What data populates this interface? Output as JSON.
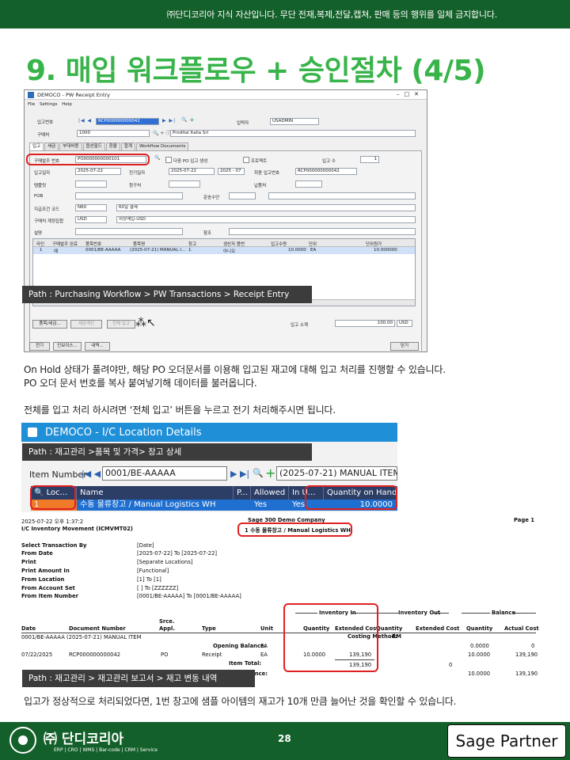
{
  "banner": "㈜단디코리아 지식 자산입니다. 무단 전재,복제,전달,캡쳐,  판매 등의 행위를 일체 금지합니다.",
  "title": "9. 매입 워크플로우 + 승인절차 (4/5)",
  "window1": {
    "title": "DEMOCO - PW Receipt Entry",
    "menu": [
      "File",
      "Settings",
      "Help"
    ],
    "receipt_no_label": "입고번호",
    "receipt_no": "RCP000000000042",
    "entered_by_label": "입력자",
    "entered_by": "USADMIN",
    "vendor_label": "구매처",
    "vendor_code": "1000",
    "vendor_name": "Prodital Italia Srl",
    "tabs": [
      "입고",
      "세금",
      "부대비용",
      "옵션필드",
      "환율",
      "합계",
      "Workflow Documents"
    ],
    "po_no_label": "구매발주 번호",
    "po_no": "PO0000000000101",
    "multi_po_label": "다중 PO 입고 생성",
    "project_label": "프로젝트",
    "receipt_count_label": "입고 수",
    "receipt_count": "1",
    "receipt_date_label": "입고일자",
    "receipt_date": "2025-07-22",
    "posting_date_label": "전기일자",
    "posting_date": "2025-07-22",
    "period": "2025 - 07",
    "last_receipt_label": "최종 입고번호",
    "last_receipt": "RCP000000000042",
    "template_label": "템플릿",
    "billing_label": "청구처",
    "delivery_label": "납품처",
    "fob_label": "FOB",
    "ship_via_label": "운송수단",
    "terms_label": "지급조건 코드",
    "terms_code": "N60",
    "terms_desc": "60일 결제",
    "account_set_label": "구매처 계정집합",
    "account_set": "USD",
    "account_set_desc": "외상매입-USD",
    "description_label": "설명",
    "reference_label": "참조",
    "grid_headers": [
      "라인",
      "구매발주 완료",
      "품목번호",
      "품목명",
      "창고",
      "생산자 품번",
      "입고수량",
      "단위",
      "단위원가"
    ],
    "grid_row": [
      "1",
      "예",
      "0001/BE-AAAAA",
      "(2025-07-21) MANUAL I...",
      "1",
      "아니오",
      "10.0000",
      "EA",
      "10.000000"
    ],
    "path": "Path : Purchasing Workflow > PW Transactions > Receipt Entry",
    "btn_items": "품목/세금...",
    "btn_tax_calc": "세금계산",
    "btn_receive_all": "전체 입고",
    "total_label": "입고 소계",
    "total": "100.00",
    "currency": "USD",
    "btn_post": "전기",
    "btn_invoice": "인보이스...",
    "btn_history": "내역...",
    "btn_close": "닫기"
  },
  "text1": [
    "On Hold 상태가 풀려야만, 해당 PO 오더문서를 이용해 입고된 재고에 대해 입고 처리를 진행할 수 있습니다.",
    "PO 오더 문서 번호를 복사 붙여넣기해 데이터를 불러옵니다."
  ],
  "text2": "전체를 입고 처리 하시려면 ‘전체 입고’ 버튼을 누르고 전기 처리해주시면 됩니다.",
  "window2": {
    "title": "DEMOCO - I/C Location Details",
    "path": "Path : 재고관리 >품목 및 가격> 창고 상세",
    "item_label": "Item Number",
    "item_value": "0001/BE-AAAAA",
    "item_desc": "(2025-07-21) MANUAL ITEM",
    "headers": [
      "Loc...",
      "Name",
      "P...",
      "Allowed",
      "In U...",
      "Quantity on Hand (EA)"
    ],
    "row": [
      "1",
      "수동 물류창고 / Manual Logistics WH",
      "",
      "Yes",
      "Yes",
      "10.0000"
    ]
  },
  "report": {
    "datetime": "2025-07-22  오후 1:37:2",
    "company": "Sage 300 Demo Company",
    "page": "Page 1",
    "name": "I/C Inventory Movement (ICMVMT02)",
    "location_title": "1  수동 물류창고 / Manual Logistics WH",
    "params": [
      [
        "Select Transaction By",
        "[Date]"
      ],
      [
        "From Date",
        "[2025-07-22]  To  [2025-07-22]"
      ],
      [
        "Print",
        "[Separate Locations]"
      ],
      [
        "Print Amount In",
        "[Functional]"
      ],
      [
        "From Location",
        "[1]  To  [1]"
      ],
      [
        "From Account Set",
        "[ ]  To  [ZZZZZZ]"
      ],
      [
        "From Item Number",
        "[0001/BE-AAAAA]  To  [0001/BE-AAAAA]"
      ]
    ],
    "group_in": "Inventory In",
    "group_out": "Inventory Out",
    "group_bal": "Balance",
    "col_date": "Date",
    "col_doc": "Document Number",
    "col_src": "Srce.",
    "col_src2": "Appl.",
    "col_type": "Type",
    "col_unit": "Unit",
    "col_qty": "Quantity",
    "col_extcost": "Extended Cost",
    "col_qty2": "Quantity",
    "col_extcost2": "Extended Cost",
    "col_qty3": "Quantity",
    "col_actual": "Actual Cost",
    "item_line": "0001/BE-AAAAA (2025-07-21) MANUAL ITEM",
    "opening_label": "Opening Balance:",
    "opening_unit": "EA",
    "opening_qty": "0.0000",
    "opening_cost": "0",
    "costing_label": "Costing Method:",
    "costing_value": "RM",
    "tx_date": "07/22/2025",
    "tx_doc": "RCP000000000042",
    "tx_src": "PO",
    "tx_type": "Receipt",
    "tx_unit": "EA",
    "tx_qty": "10.0000",
    "tx_cost": "139,190",
    "tx_bal_qty": "10.0000",
    "tx_bal_cost": "139,190",
    "item_total_label": "Item Total:",
    "item_total_cost": "139,190",
    "item_total_out": "0",
    "ending_label": "nding Balance:",
    "ending_qty": "10.0000",
    "ending_cost": "139,190",
    "path": "Path : 재고관리 > 재고관리 보고서 > 재고 변동 내역"
  },
  "text3": "입고가 정상적으로 처리되었다면, 1번 창고에 샘플 아이템의 재고가 10개 만큼 늘어난 것을 확인할 수 있습니다.",
  "footer": {
    "brand": "㈜ 단디코리아",
    "tagline": "ERP | CRO | WMS | Bar-code | CRM | Service",
    "page_number": "28",
    "partner": "Sage Partner"
  }
}
